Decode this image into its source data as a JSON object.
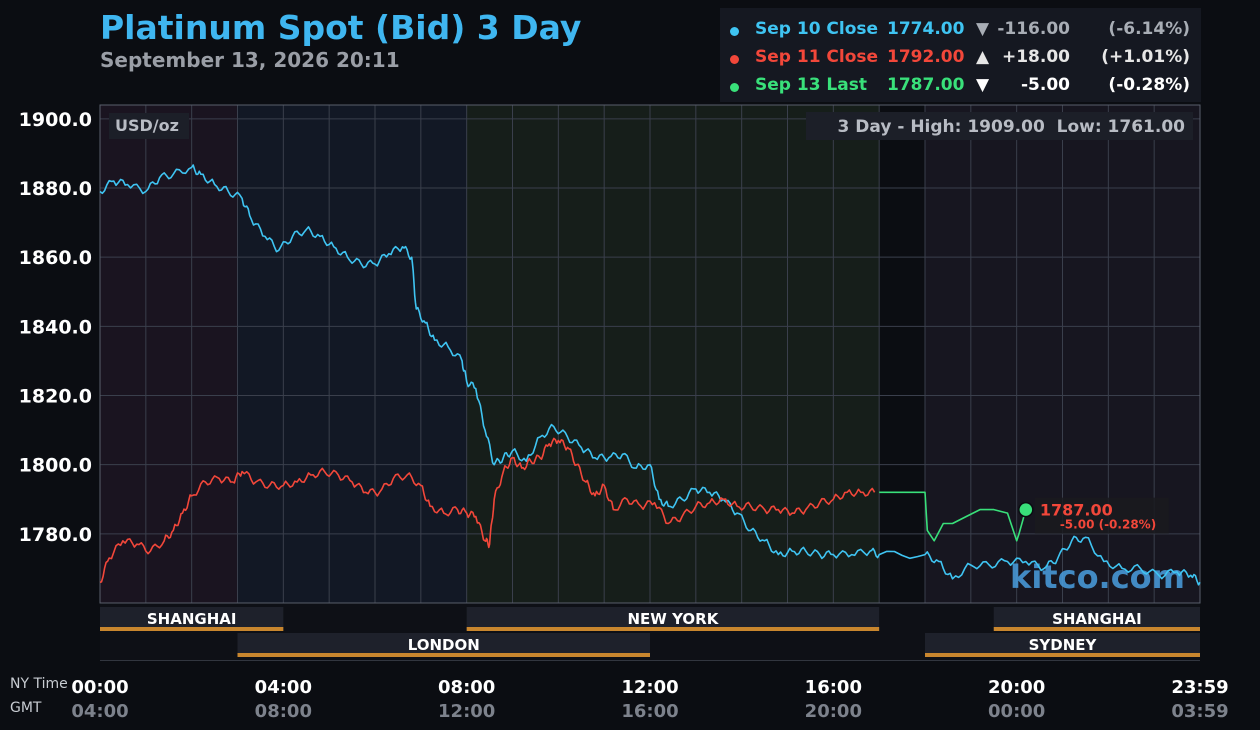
{
  "header": {
    "title": "Platinum Spot (Bid) 3 Day",
    "subtitle": "September 13, 2026 20:11"
  },
  "legend": [
    {
      "name": "Sep 10 Close",
      "price": "1774.00",
      "arrow": "▼",
      "change": "-116.00",
      "pct": "(-6.14%)",
      "color": "#3fc4f2",
      "changeColor": "#a8adb5"
    },
    {
      "name": "Sep 11 Close",
      "price": "1792.00",
      "arrow": "▲",
      "change": "+18.00",
      "pct": "(+1.01%)",
      "color": "#f2473a",
      "changeColor": "#e6e6e6"
    },
    {
      "name": "Sep 13 Last",
      "price": "1787.00",
      "arrow": "▼",
      "change": "-5.00",
      "pct": "(-0.28%)",
      "color": "#39e07a",
      "changeColor": "#ffffff"
    }
  ],
  "unit_label": "USD/oz",
  "range_label": "3 Day - High: 1909.00  Low: 1761.00",
  "watermark": "kitco.com",
  "last_marker": {
    "price": "1787.00",
    "change": "-5.00 (-0.28%)"
  },
  "axis_rows": {
    "ny": "NY Time",
    "gmt": "GMT"
  },
  "sessions": [
    {
      "name": "SHANGHAI",
      "start": 0,
      "end": 4,
      "row": 0
    },
    {
      "name": "NEW YORK",
      "start": 8,
      "end": 17,
      "row": 0
    },
    {
      "name": "SHANGHAI",
      "start": 19.5,
      "end": 24,
      "row": 0
    },
    {
      "name": "LONDON",
      "start": 3,
      "end": 12,
      "row": 1
    },
    {
      "name": "SYDNEY",
      "start": 18,
      "end": 24,
      "row": 1
    }
  ],
  "colors": {
    "sep10": "#3fc4f2",
    "sep11": "#f2473a",
    "sep13": "#39e07a",
    "session_bar": "#c8862e"
  },
  "chart_data": {
    "type": "line",
    "title": "Platinum Spot (Bid) 3 Day",
    "ylabel": "USD/oz",
    "ylim": [
      1760,
      1904
    ],
    "yticks": [
      1780.0,
      1800.0,
      1820.0,
      1840.0,
      1860.0,
      1880.0,
      1900.0
    ],
    "ytick_labels": [
      "1780.0",
      "1800.0",
      "1820.0",
      "1840.0",
      "1860.0",
      "1880.0",
      "1900.0"
    ],
    "xlim": [
      0,
      24
    ],
    "xticks": [
      0,
      4,
      8,
      12,
      16,
      20,
      24
    ],
    "xtick_labels_ny": [
      "00:00",
      "04:00",
      "08:00",
      "12:00",
      "16:00",
      "20:00",
      "23:59"
    ],
    "xtick_labels_gmt": [
      "04:00",
      "08:00",
      "12:00",
      "16:00",
      "20:00",
      "00:00",
      "03:59"
    ],
    "grid": true,
    "series": [
      {
        "name": "Sep 10 Close",
        "color": "#3fc4f2",
        "x": [
          0,
          0.3,
          0.6,
          1.0,
          1.3,
          1.6,
          2.0,
          2.2,
          2.5,
          2.8,
          3.1,
          3.3,
          3.6,
          3.9,
          4.2,
          4.5,
          4.8,
          5.1,
          5.4,
          5.7,
          6.0,
          6.3,
          6.6,
          6.8,
          6.9,
          7.1,
          7.3,
          7.6,
          7.9,
          8.0,
          8.2,
          8.4,
          8.6,
          8.8,
          9.0,
          9.3,
          9.6,
          9.9,
          10.2,
          10.5,
          10.8,
          11.1,
          11.4,
          11.7,
          12.0,
          12.2,
          12.4,
          12.7,
          13.0,
          13.3,
          13.6,
          13.9,
          14.2,
          14.5,
          14.8,
          15.1,
          15.4,
          15.7,
          16.0,
          16.4,
          16.8,
          17.0,
          18.0,
          18.3,
          18.6,
          19.0,
          19.4,
          19.8,
          20.2,
          20.6,
          20.9,
          21.2,
          21.5,
          21.9,
          22.3,
          22.7,
          23.1,
          23.5,
          23.8,
          24.0
        ],
        "y": [
          1879,
          1882,
          1881,
          1879,
          1883,
          1884,
          1886,
          1884,
          1881,
          1879,
          1877,
          1871,
          1866,
          1862,
          1866,
          1868,
          1866,
          1863,
          1860,
          1858,
          1858,
          1861,
          1863,
          1860,
          1845,
          1841,
          1836,
          1834,
          1830,
          1824,
          1822,
          1810,
          1800,
          1802,
          1804,
          1801,
          1808,
          1811,
          1808,
          1805,
          1802,
          1802,
          1803,
          1799,
          1800,
          1790,
          1788,
          1790,
          1793,
          1792,
          1790,
          1786,
          1781,
          1778,
          1774,
          1775,
          1775,
          1774,
          1774,
          1774,
          1775,
          1774,
          1774,
          1772,
          1767,
          1771,
          1771,
          1772,
          1772,
          1770,
          1773,
          1778,
          1779,
          1772,
          1770,
          1770,
          1768,
          1769,
          1768,
          1766
        ]
      },
      {
        "name": "Sep 11 Close",
        "color": "#f2473a",
        "x": [
          0,
          0.2,
          0.5,
          0.8,
          1.1,
          1.4,
          1.6,
          1.8,
          2.0,
          2.3,
          2.6,
          2.9,
          3.1,
          3.4,
          3.7,
          4.0,
          4.3,
          4.6,
          4.9,
          5.2,
          5.5,
          5.8,
          6.1,
          6.4,
          6.7,
          7.0,
          7.2,
          7.5,
          7.8,
          8.0,
          8.2,
          8.4,
          8.5,
          8.6,
          8.8,
          9.0,
          9.2,
          9.4,
          9.6,
          9.8,
          10.0,
          10.2,
          10.4,
          10.6,
          10.8,
          11.0,
          11.2,
          11.5,
          11.8,
          12.1,
          12.4,
          12.7,
          13.0,
          13.3,
          13.6,
          13.9,
          14.2,
          14.5,
          14.8,
          15.1,
          15.4,
          15.7,
          16.0,
          16.3,
          16.6,
          16.9
        ],
        "y": [
          1766,
          1773,
          1778,
          1777,
          1775,
          1778,
          1781,
          1786,
          1791,
          1795,
          1796,
          1795,
          1798,
          1795,
          1794,
          1794,
          1795,
          1797,
          1798,
          1797,
          1795,
          1792,
          1792,
          1796,
          1797,
          1794,
          1788,
          1786,
          1787,
          1786,
          1785,
          1778,
          1777,
          1790,
          1798,
          1802,
          1799,
          1801,
          1802,
          1806,
          1807,
          1805,
          1800,
          1795,
          1791,
          1794,
          1787,
          1790,
          1788,
          1789,
          1783,
          1785,
          1788,
          1789,
          1790,
          1788,
          1788,
          1787,
          1787,
          1786,
          1787,
          1789,
          1790,
          1792,
          1792,
          1792
        ]
      },
      {
        "name": "Sep 13 Last",
        "color": "#39e07a",
        "x": [
          17.0,
          18.0,
          18.05,
          18.2,
          18.4,
          18.6,
          18.9,
          19.2,
          19.5,
          19.8,
          20.0,
          20.05,
          20.2
        ],
        "y": [
          1792,
          1792,
          1781,
          1778,
          1783,
          1783,
          1785,
          1787,
          1787,
          1786,
          1778,
          1780,
          1787
        ]
      }
    ]
  }
}
